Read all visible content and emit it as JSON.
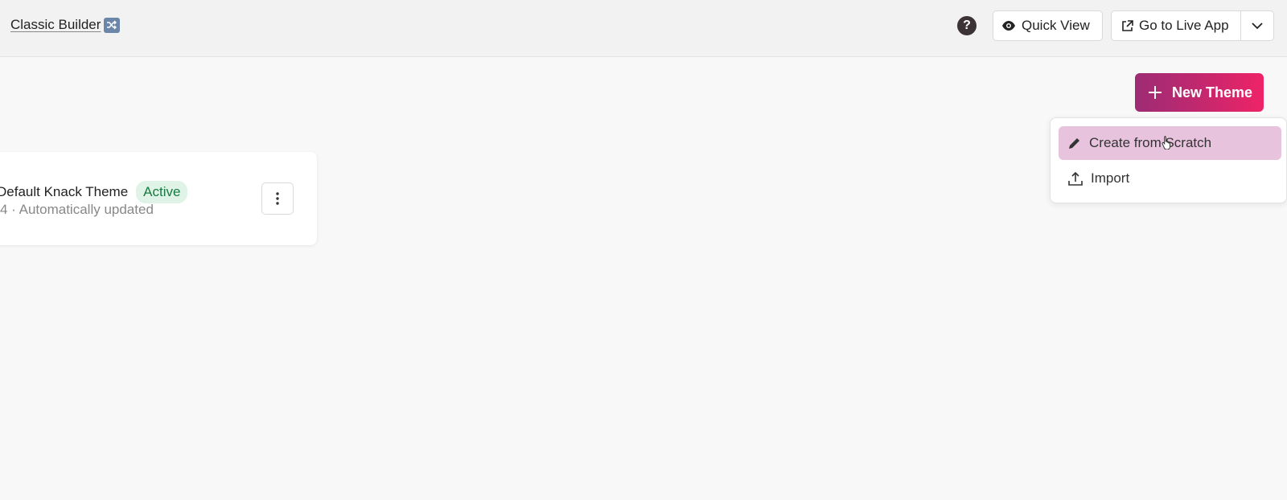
{
  "header": {
    "classic_builder_label": "Classic Builder",
    "quick_view_label": "Quick View",
    "go_live_label": "Go to Live App",
    "help_label": "?"
  },
  "actions": {
    "new_theme_label": "New Theme"
  },
  "new_theme_menu": {
    "items": [
      {
        "label": "Create from Scratch",
        "icon": "pencil-icon",
        "highlighted": true
      },
      {
        "label": "Import",
        "icon": "upload-icon",
        "highlighted": false
      }
    ]
  },
  "theme_card": {
    "name": "Default Knack Theme",
    "badge": "Active",
    "meta": "4 · Automatically updated"
  },
  "colors": {
    "accent_gradient_start": "#9d2c74",
    "accent_gradient_end": "#ef2367",
    "menu_highlight": "#e8c3de",
    "badge_bg": "#dff3e6",
    "badge_text": "#177a41"
  }
}
